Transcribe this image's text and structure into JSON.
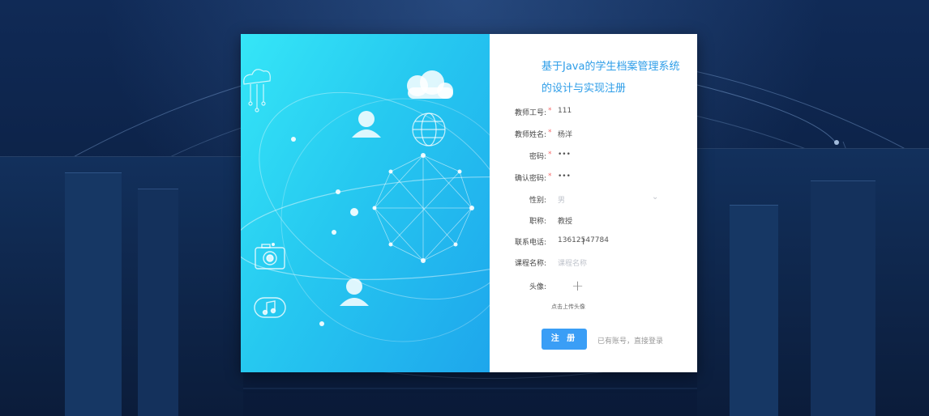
{
  "title": {
    "line1": "基于Java的学生档案管理系统",
    "line2": "的设计与实现注册"
  },
  "form": {
    "teacher_id": {
      "label": "教师工号:",
      "required": "*",
      "value": "111"
    },
    "teacher_name": {
      "label": "教师姓名:",
      "required": "*",
      "value": "杨洋"
    },
    "password": {
      "label": "密码:",
      "required": "*",
      "value": "•••"
    },
    "confirm_password": {
      "label": "确认密码:",
      "required": "*",
      "value": "•••"
    },
    "gender": {
      "label": "性别:",
      "value": "男"
    },
    "title": {
      "label": "职称:",
      "value": "教授"
    },
    "phone": {
      "label": "联系电话:",
      "value": "13612547784"
    },
    "course": {
      "label": "课程名称:",
      "placeholder": "课程名称"
    },
    "avatar": {
      "label": "头像:",
      "upload_icon": "+",
      "tip": "点击上传头像"
    }
  },
  "buttons": {
    "register": "注 册",
    "login_link": "已有账号，直接登录"
  },
  "colors": {
    "accent": "#3a9ef6",
    "title": "#2d9de8",
    "required": "#f56c6c"
  },
  "icons": [
    "cloud-icon",
    "user-icon",
    "globe-icon",
    "camera-icon",
    "music-icon",
    "cloud-network-icon"
  ]
}
